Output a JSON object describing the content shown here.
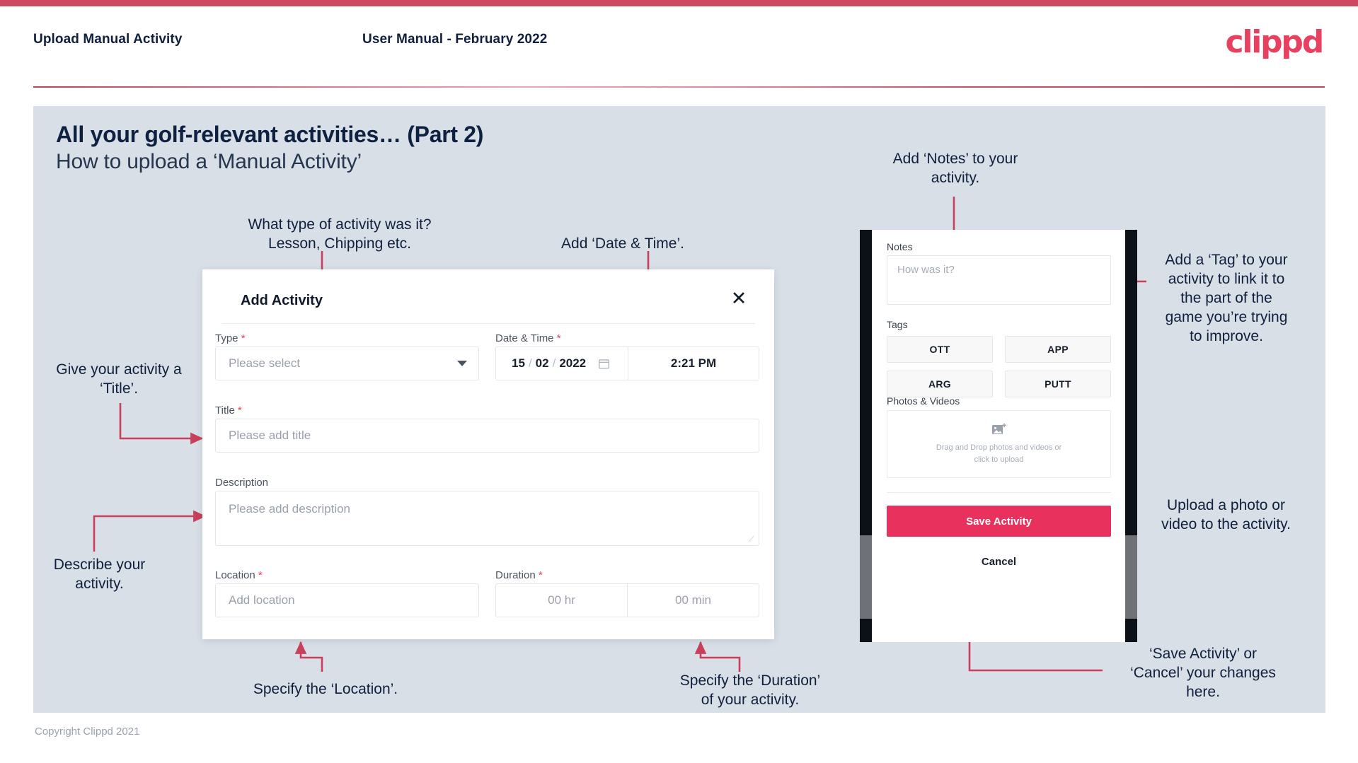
{
  "header": {
    "title": "Upload Manual Activity",
    "subtitle": "User Manual - February 2022",
    "brand": "clippd",
    "accent_color": "#cd4861"
  },
  "slide": {
    "heading": "All your golf-relevant activities… (Part 2)",
    "subheading": "How to upload a ‘Manual Activity’",
    "background_color": "#d9dfe7"
  },
  "footer": {
    "copyright": "Copyright Clippd 2021"
  },
  "dialog": {
    "title": "Add Activity",
    "close_icon": "close-icon",
    "fields": {
      "type": {
        "label": "Type",
        "required": "*",
        "placeholder": "Please select",
        "dropdown_icon": "chevron-down-icon"
      },
      "datetime": {
        "label": "Date & Time",
        "required": "*",
        "day": "15",
        "sep1": "/",
        "month": "02",
        "sep2": "/",
        "year": "2022",
        "calendar_icon": "calendar-icon",
        "time": "2:21 PM"
      },
      "title": {
        "label": "Title",
        "required": "*",
        "placeholder": "Please add title"
      },
      "description": {
        "label": "Description",
        "required": "",
        "placeholder": "Please add description"
      },
      "location": {
        "label": "Location",
        "required": "*",
        "placeholder": "Add location"
      },
      "duration": {
        "label": "Duration",
        "required": "*",
        "hours_placeholder": "00 hr",
        "minutes_placeholder": "00 min"
      }
    }
  },
  "phone": {
    "notes": {
      "label": "Notes",
      "placeholder": "How was it?"
    },
    "tags": {
      "label": "Tags",
      "options": [
        "OTT",
        "APP",
        "ARG",
        "PUTT"
      ]
    },
    "photos": {
      "label": "Photos & Videos",
      "upload_icon": "image-add-icon",
      "dropzone_line1": "Drag and Drop photos and videos or",
      "dropzone_line2": "click to upload"
    },
    "save_label": "Save Activity",
    "cancel_label": "Cancel",
    "save_color": "#e8315c"
  },
  "annotations": {
    "type": "What type of activity was it?\nLesson, Chipping etc.",
    "datetime": "Add ‘Date & Time’.",
    "title": "Give your activity a\n‘Title’.",
    "description": "Describe your\nactivity.",
    "location": "Specify the ‘Location’.",
    "duration": "Specify the ‘Duration’\nof your activity.",
    "notes": "Add ‘Notes’ to your\nactivity.",
    "tags": "Add a ‘Tag’ to your\nactivity to link it to\nthe part of the\ngame you’re trying\nto improve.",
    "photos": "Upload a photo or\nvideo to the activity.",
    "save": "‘Save Activity’ or\n‘Cancel’ your changes\nhere.",
    "line_color": "#c9405c"
  }
}
